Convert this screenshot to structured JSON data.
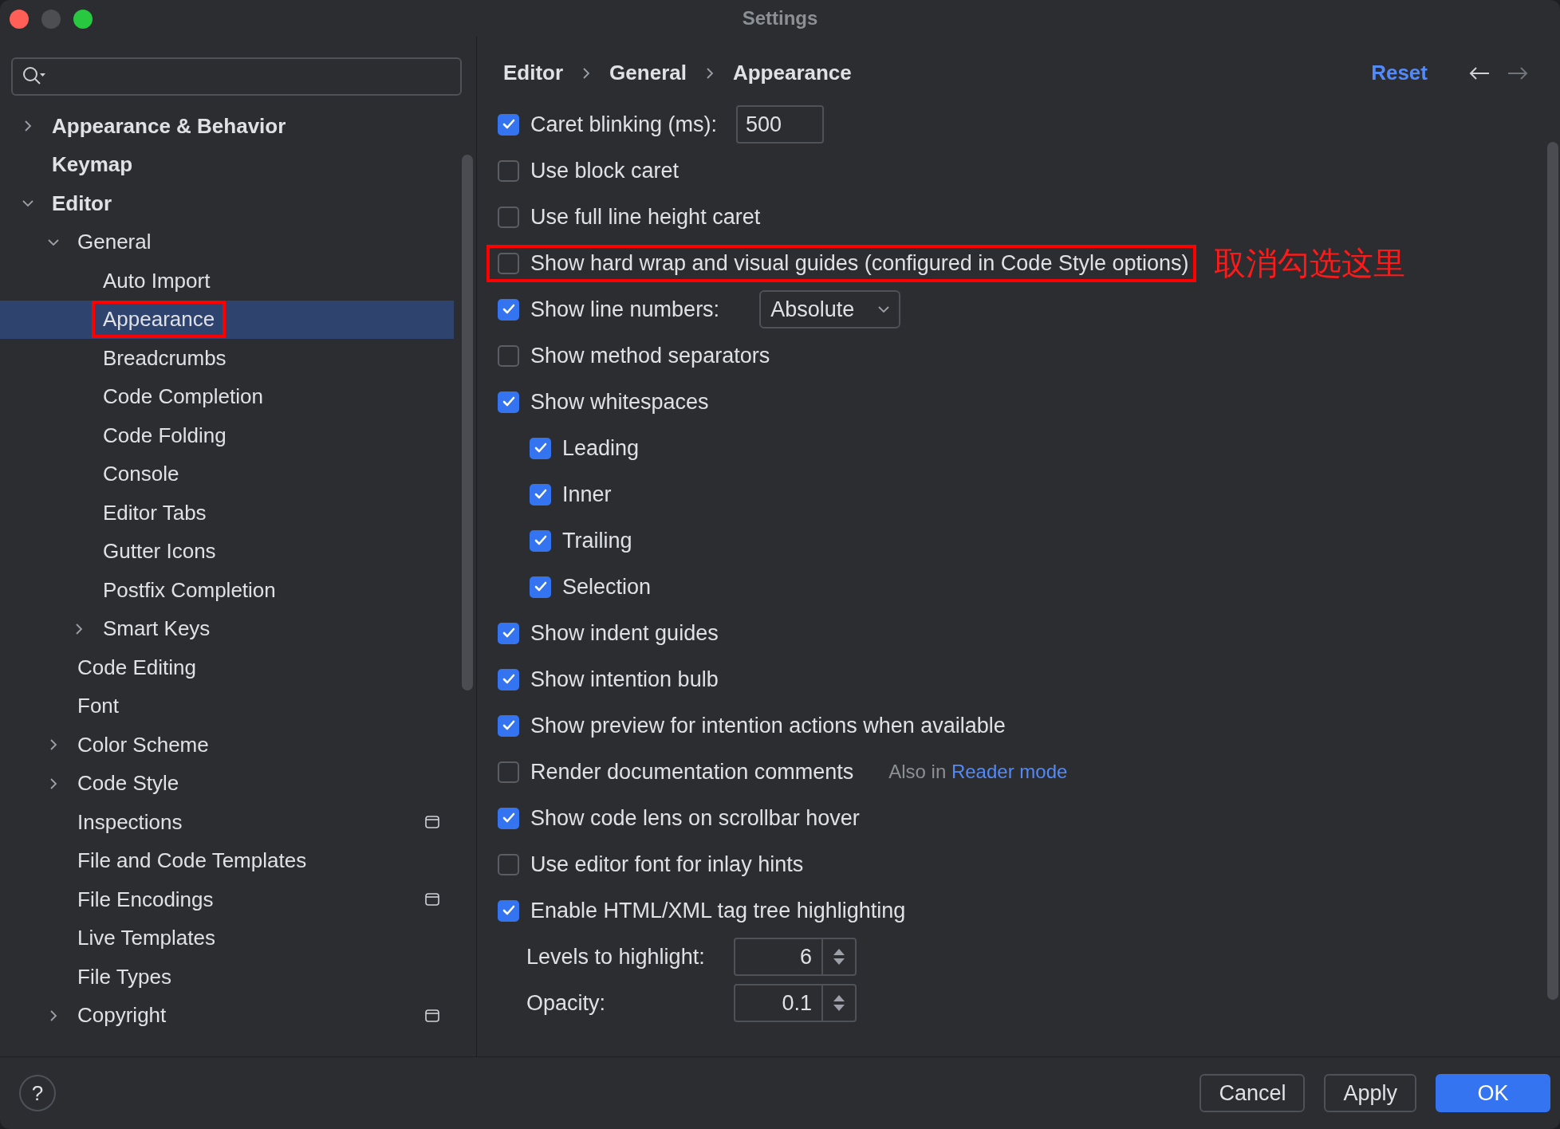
{
  "window": {
    "title": "Settings"
  },
  "sidebar": {
    "items": [
      {
        "label": "Appearance & Behavior",
        "kind": "group",
        "expanded": false,
        "selected": false
      },
      {
        "label": "Keymap",
        "kind": "page",
        "selected": false
      },
      {
        "label": "Editor",
        "kind": "group",
        "expanded": true,
        "selected": false,
        "children": [
          {
            "label": "General",
            "kind": "group",
            "expanded": true,
            "selected": false,
            "children": [
              {
                "label": "Auto Import",
                "kind": "page",
                "selected": false
              },
              {
                "label": "Appearance",
                "kind": "page",
                "selected": true,
                "highlighted": true
              },
              {
                "label": "Breadcrumbs",
                "kind": "page",
                "selected": false
              },
              {
                "label": "Code Completion",
                "kind": "page",
                "selected": false
              },
              {
                "label": "Code Folding",
                "kind": "page",
                "selected": false
              },
              {
                "label": "Console",
                "kind": "page",
                "selected": false
              },
              {
                "label": "Editor Tabs",
                "kind": "page",
                "selected": false
              },
              {
                "label": "Gutter Icons",
                "kind": "page",
                "selected": false
              },
              {
                "label": "Postfix Completion",
                "kind": "page",
                "selected": false
              },
              {
                "label": "Smart Keys",
                "kind": "group",
                "expanded": false,
                "selected": false
              }
            ]
          },
          {
            "label": "Code Editing",
            "kind": "page",
            "selected": false
          },
          {
            "label": "Font",
            "kind": "page",
            "selected": false
          },
          {
            "label": "Color Scheme",
            "kind": "group",
            "expanded": false,
            "selected": false
          },
          {
            "label": "Code Style",
            "kind": "group",
            "expanded": false,
            "selected": false
          },
          {
            "label": "Inspections",
            "kind": "page",
            "selected": false,
            "project_scoped": true
          },
          {
            "label": "File and Code Templates",
            "kind": "page",
            "selected": false
          },
          {
            "label": "File Encodings",
            "kind": "page",
            "selected": false,
            "project_scoped": true
          },
          {
            "label": "Live Templates",
            "kind": "page",
            "selected": false
          },
          {
            "label": "File Types",
            "kind": "page",
            "selected": false
          },
          {
            "label": "Copyright",
            "kind": "group",
            "expanded": false,
            "selected": false,
            "project_scoped": true
          }
        ]
      }
    ]
  },
  "header": {
    "breadcrumbs": [
      "Editor",
      "General",
      "Appearance"
    ],
    "reset": "Reset"
  },
  "options": [
    {
      "kind": "checkbox",
      "label": "Caret blinking (ms):",
      "checked": true,
      "value": "500"
    },
    {
      "kind": "checkbox",
      "label": "Use block caret",
      "checked": false
    },
    {
      "kind": "checkbox",
      "label": "Use full line height caret",
      "checked": false
    },
    {
      "kind": "checkbox",
      "label": "Show hard wrap and visual guides (configured in Code Style options)",
      "checked": false,
      "highlighted": true,
      "annotation": "取消勾选这里"
    },
    {
      "kind": "checkbox",
      "label": "Show line numbers:",
      "checked": true,
      "dropdown": "Absolute"
    },
    {
      "kind": "checkbox",
      "label": "Show method separators",
      "checked": false
    },
    {
      "kind": "checkbox",
      "label": "Show whitespaces",
      "checked": true,
      "children": [
        {
          "kind": "checkbox",
          "label": "Leading",
          "checked": true
        },
        {
          "kind": "checkbox",
          "label": "Inner",
          "checked": true
        },
        {
          "kind": "checkbox",
          "label": "Trailing",
          "checked": true
        },
        {
          "kind": "checkbox",
          "label": "Selection",
          "checked": true
        }
      ]
    },
    {
      "kind": "checkbox",
      "label": "Show indent guides",
      "checked": true
    },
    {
      "kind": "checkbox",
      "label": "Show intention bulb",
      "checked": true
    },
    {
      "kind": "checkbox",
      "label": "Show preview for intention actions when available",
      "checked": true
    },
    {
      "kind": "checkbox",
      "label": "Render documentation comments",
      "checked": false,
      "note": "Also in",
      "link": "Reader mode"
    },
    {
      "kind": "checkbox",
      "label": "Show code lens on scrollbar hover",
      "checked": true
    },
    {
      "kind": "checkbox",
      "label": "Use editor font for inlay hints",
      "checked": false
    },
    {
      "kind": "checkbox",
      "label": "Enable HTML/XML tag tree highlighting",
      "checked": true,
      "children": [
        {
          "kind": "spinner",
          "label": "Levels to highlight:",
          "value": "6"
        },
        {
          "kind": "spinner",
          "label": "Opacity:",
          "value": "0.1"
        }
      ]
    }
  ],
  "help": "?",
  "buttons": [
    {
      "label": "Cancel",
      "primary": false
    },
    {
      "label": "Apply",
      "primary": false
    },
    {
      "label": "OK",
      "primary": true
    }
  ]
}
